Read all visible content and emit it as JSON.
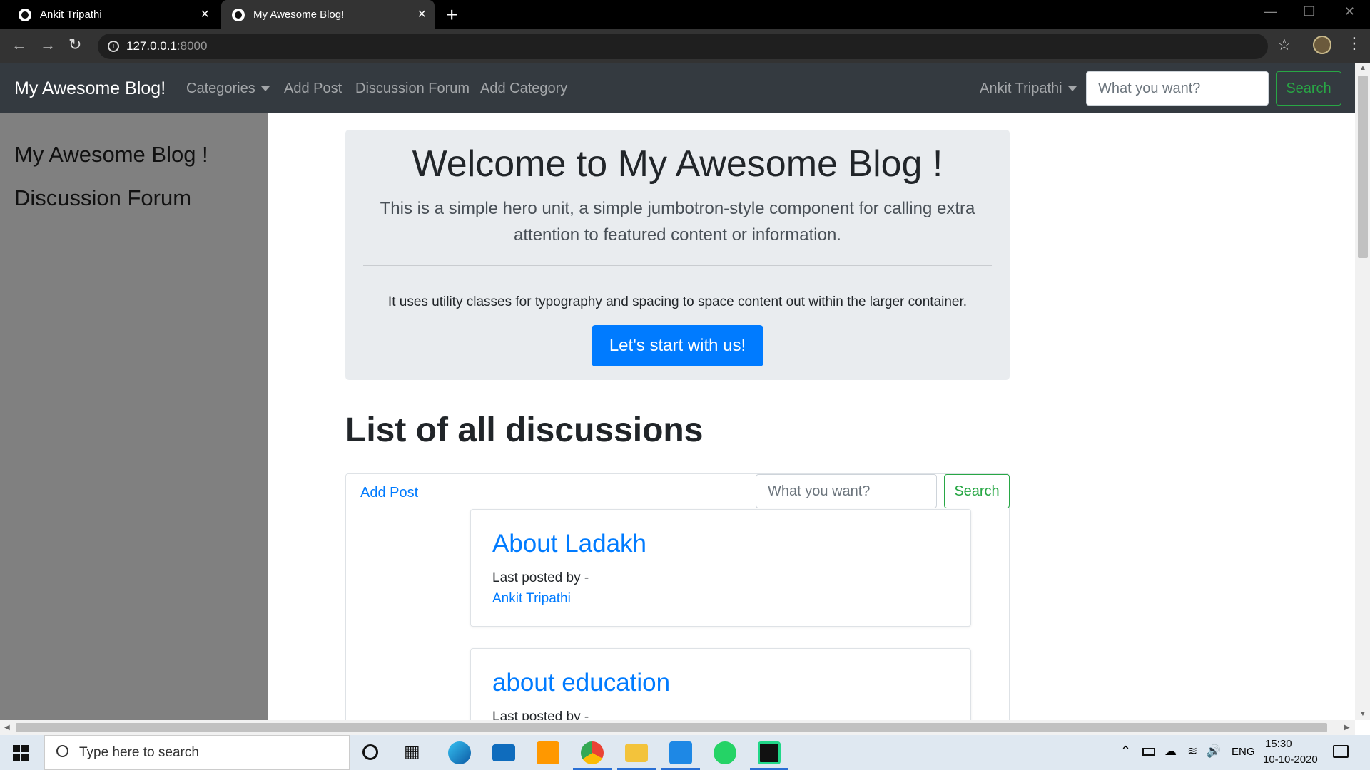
{
  "browser": {
    "tabs": [
      {
        "title": "Ankit Tripathi",
        "active": false
      },
      {
        "title": "My Awesome Blog!",
        "active": true
      }
    ],
    "new_tab": "+",
    "close_glyph": "×",
    "address": {
      "host": "127.0.0.1",
      "port": ":8000"
    }
  },
  "navbar": {
    "brand": "My Awesome Blog!",
    "links": [
      "Categories",
      "Add Post",
      "Discussion Forum",
      "Add Category"
    ],
    "user": "Ankit Tripathi",
    "search_placeholder": "What you want?",
    "search_button": "Search"
  },
  "sidebar": {
    "items": [
      "My Awesome Blog !",
      "Discussion Forum"
    ]
  },
  "jumbotron": {
    "title": "Welcome to My Awesome Blog !",
    "lead": "This is a simple hero unit, a simple jumbotron-style component for calling extra attention to featured content or information.",
    "text": "It uses utility classes for typography and spacing to space content out within the larger container.",
    "button": "Let's start with us!"
  },
  "discussions": {
    "heading": "List of all discussions",
    "add_post": "Add Post",
    "search_placeholder": "What you want?",
    "search_button": "Search",
    "posts": [
      {
        "title": "About Ladakh",
        "meta": "Last posted by -",
        "author": "Ankit Tripathi"
      },
      {
        "title": "about education",
        "meta": "Last posted by -",
        "author": ""
      }
    ]
  },
  "taskbar": {
    "search_placeholder": "Type here to search",
    "apps": [
      "cortana-icon",
      "task-view-icon",
      "edge-icon",
      "mail-icon",
      "sublime-text-icon",
      "chrome-icon",
      "file-explorer-icon",
      "vscode-icon",
      "whatsapp-icon",
      "pycharm-icon"
    ],
    "language": "ENG",
    "time": "15:30",
    "date": "10-10-2020"
  },
  "colors": {
    "primary": "#007bff",
    "success": "#28a745",
    "navbar": "#343a40",
    "sidebar": "#808080",
    "jumbotron": "#e9ecef"
  }
}
